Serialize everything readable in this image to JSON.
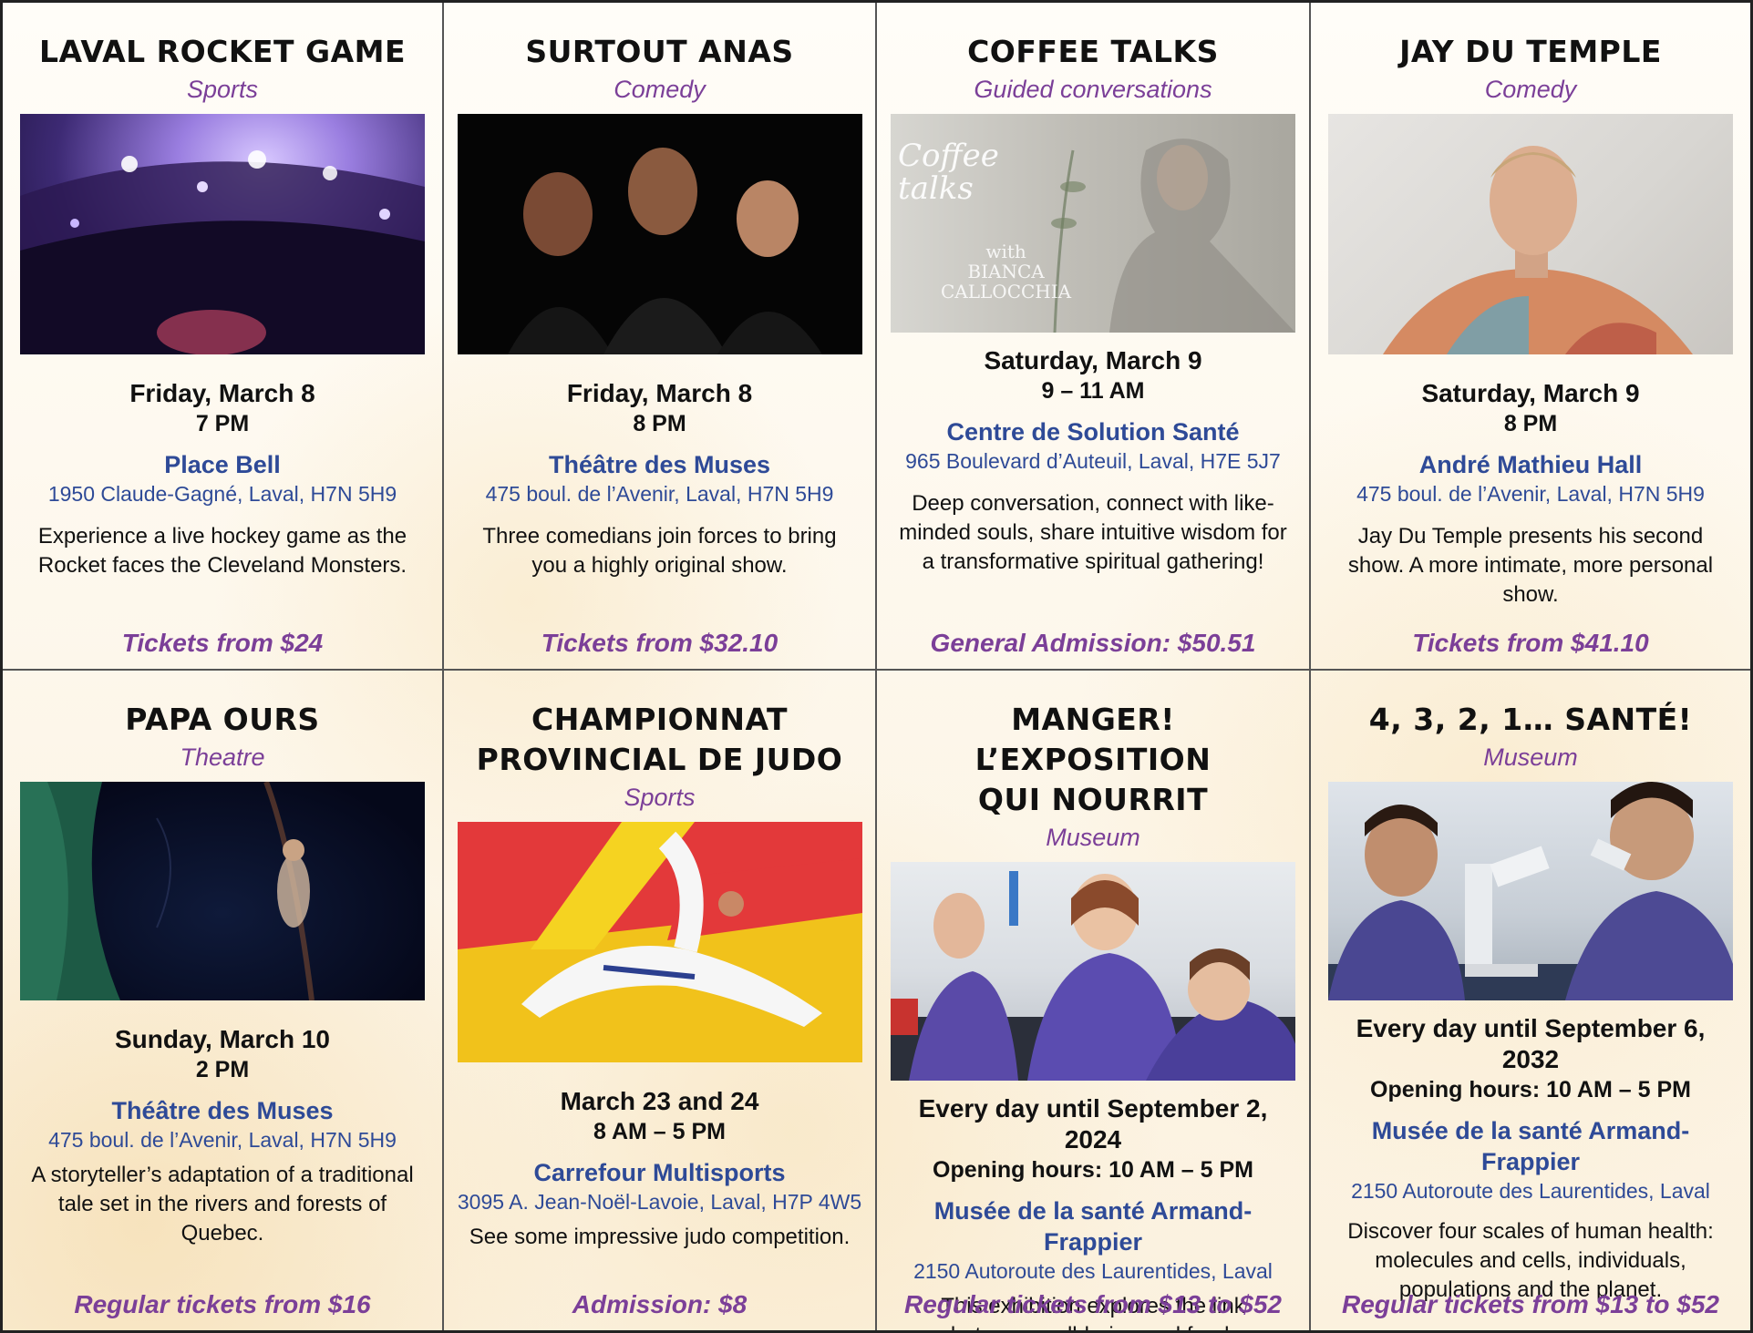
{
  "events": [
    {
      "title": "LAVAL ROCKET GAME",
      "category": "Sports",
      "date": "Friday, March 8",
      "time": "7 PM",
      "venue": "Place Bell",
      "address": "1950 Claude-Gagné, Laval, H7N 5H9",
      "description": "Experience a live hockey game as the Rocket faces the Cleveland Monsters.",
      "price": "Tickets from $24"
    },
    {
      "title": "SURTOUT ANAS",
      "category": "Comedy",
      "date": "Friday, March 8",
      "time": "8 PM",
      "venue": "Théâtre des Muses",
      "address": "475 boul. de l’Avenir, Laval, H7N 5H9",
      "description": "Three comedians join forces to bring you a highly original show.",
      "price": "Tickets from $32.10"
    },
    {
      "title": "COFFEE TALKS",
      "category": "Guided conversations",
      "image_text": "Coffee\n   talks",
      "image_subtext": "with\nBIANCA\nCALLOCCHIA",
      "date": "Saturday, March 9",
      "time": "9 – 11 AM",
      "venue": "Centre de Solution Santé",
      "address": "965 Boulevard d’Auteuil, Laval, H7E 5J7",
      "description": "Deep conversation, connect with like-minded souls, share intuitive wisdom for a transformative spiritual gathering!",
      "price": "General Admission: $50.51"
    },
    {
      "title": "JAY DU TEMPLE",
      "category": "Comedy",
      "date": "Saturday, March 9",
      "time": "8 PM",
      "venue": "André Mathieu Hall",
      "address": "475 boul. de l’Avenir, Laval, H7N 5H9",
      "description": "Jay Du Temple presents his second show. A more intimate, more personal show.",
      "price": "Tickets from $41.10"
    },
    {
      "title": "PAPA OURS",
      "category": "Theatre",
      "date": "Sunday, March 10",
      "time": "2 PM",
      "venue": "Théâtre des Muses",
      "address": "475 boul. de l’Avenir, Laval, H7N 5H9",
      "description": "A storyteller’s adaptation of a traditional tale set in the rivers and forests of Quebec.",
      "price": "Regular tickets from $16"
    },
    {
      "title": "CHAMPIONNAT\nPROVINCIAL DE JUDO",
      "category": "Sports",
      "date": "March 23 and 24",
      "time": "8 AM – 5 PM",
      "venue": "Carrefour Multisports",
      "address": "3095 A. Jean-Noël-Lavoie, Laval, H7P 4W5",
      "description": "See some impressive judo competition.",
      "price": "Admission: $8"
    },
    {
      "title": "MANGER! L’EXPOSITION\nQUI NOURRIT",
      "category": "Museum",
      "date": "Every day until September 2, 2024",
      "time": "Opening hours: 10 AM – 5 PM",
      "venue": "Musée de la santé Armand-Frappier",
      "address": "2150 Autoroute des Laurentides, Laval",
      "description": "This exhibition explores the link between well-being and food.",
      "price": "Regular tickets from $13 to $52"
    },
    {
      "title": "4, 3, 2, 1… SANTÉ!",
      "category": "Museum",
      "date": "Every day until September 6, 2032",
      "time": "Opening hours: 10 AM – 5 PM",
      "venue": "Musée de la santé Armand-Frappier",
      "address": "2150 Autoroute des Laurentides, Laval",
      "description": "Discover four scales of human health: molecules and cells, individuals, populations and the planet.",
      "price": "Regular tickets from $13 to $52"
    }
  ]
}
